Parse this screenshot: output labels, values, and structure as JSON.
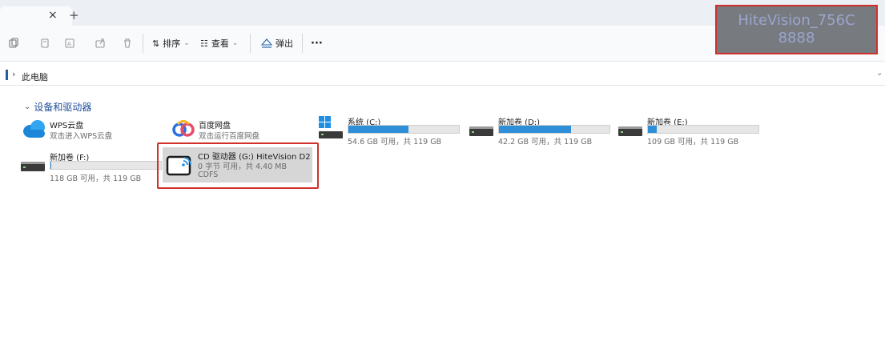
{
  "tabs": {
    "close_glyph": "×",
    "new_glyph": "+"
  },
  "toolbar": {
    "sort_label": "排序",
    "view_label": "查看",
    "eject_label": "弹出",
    "more_label": "···"
  },
  "address": {
    "path": "此电脑"
  },
  "section": {
    "title": "设备和驱动器"
  },
  "items": {
    "wps": {
      "title": "WPS云盘",
      "sub": "双击进入WPS云盘"
    },
    "baidu": {
      "title": "百度网盘",
      "sub": "双击运行百度网盘"
    },
    "c": {
      "title": "系统 (C:)",
      "sub": "54.6 GB 可用，共 119 GB",
      "used_fraction": 0.54
    },
    "d": {
      "title": "新加卷 (D:)",
      "sub": "42.2 GB 可用，共 119 GB",
      "used_fraction": 0.65
    },
    "e": {
      "title": "新加卷 (E:)",
      "sub": "109 GB 可用，共 119 GB",
      "used_fraction": 0.08
    },
    "f": {
      "title": "新加卷 (F:)",
      "sub": "118 GB 可用，共 119 GB",
      "used_fraction": 0.01
    },
    "g": {
      "title": "CD 驱动器 (G:) HiteVision D2",
      "sub": "0 字节 可用，共 4.40 MB",
      "fs": "CDFS"
    }
  },
  "overlay": {
    "line1": "HiteVision_756C",
    "line2": "8888"
  },
  "colors": {
    "accent": "#2e8fd8",
    "highlight": "#d0302a"
  }
}
